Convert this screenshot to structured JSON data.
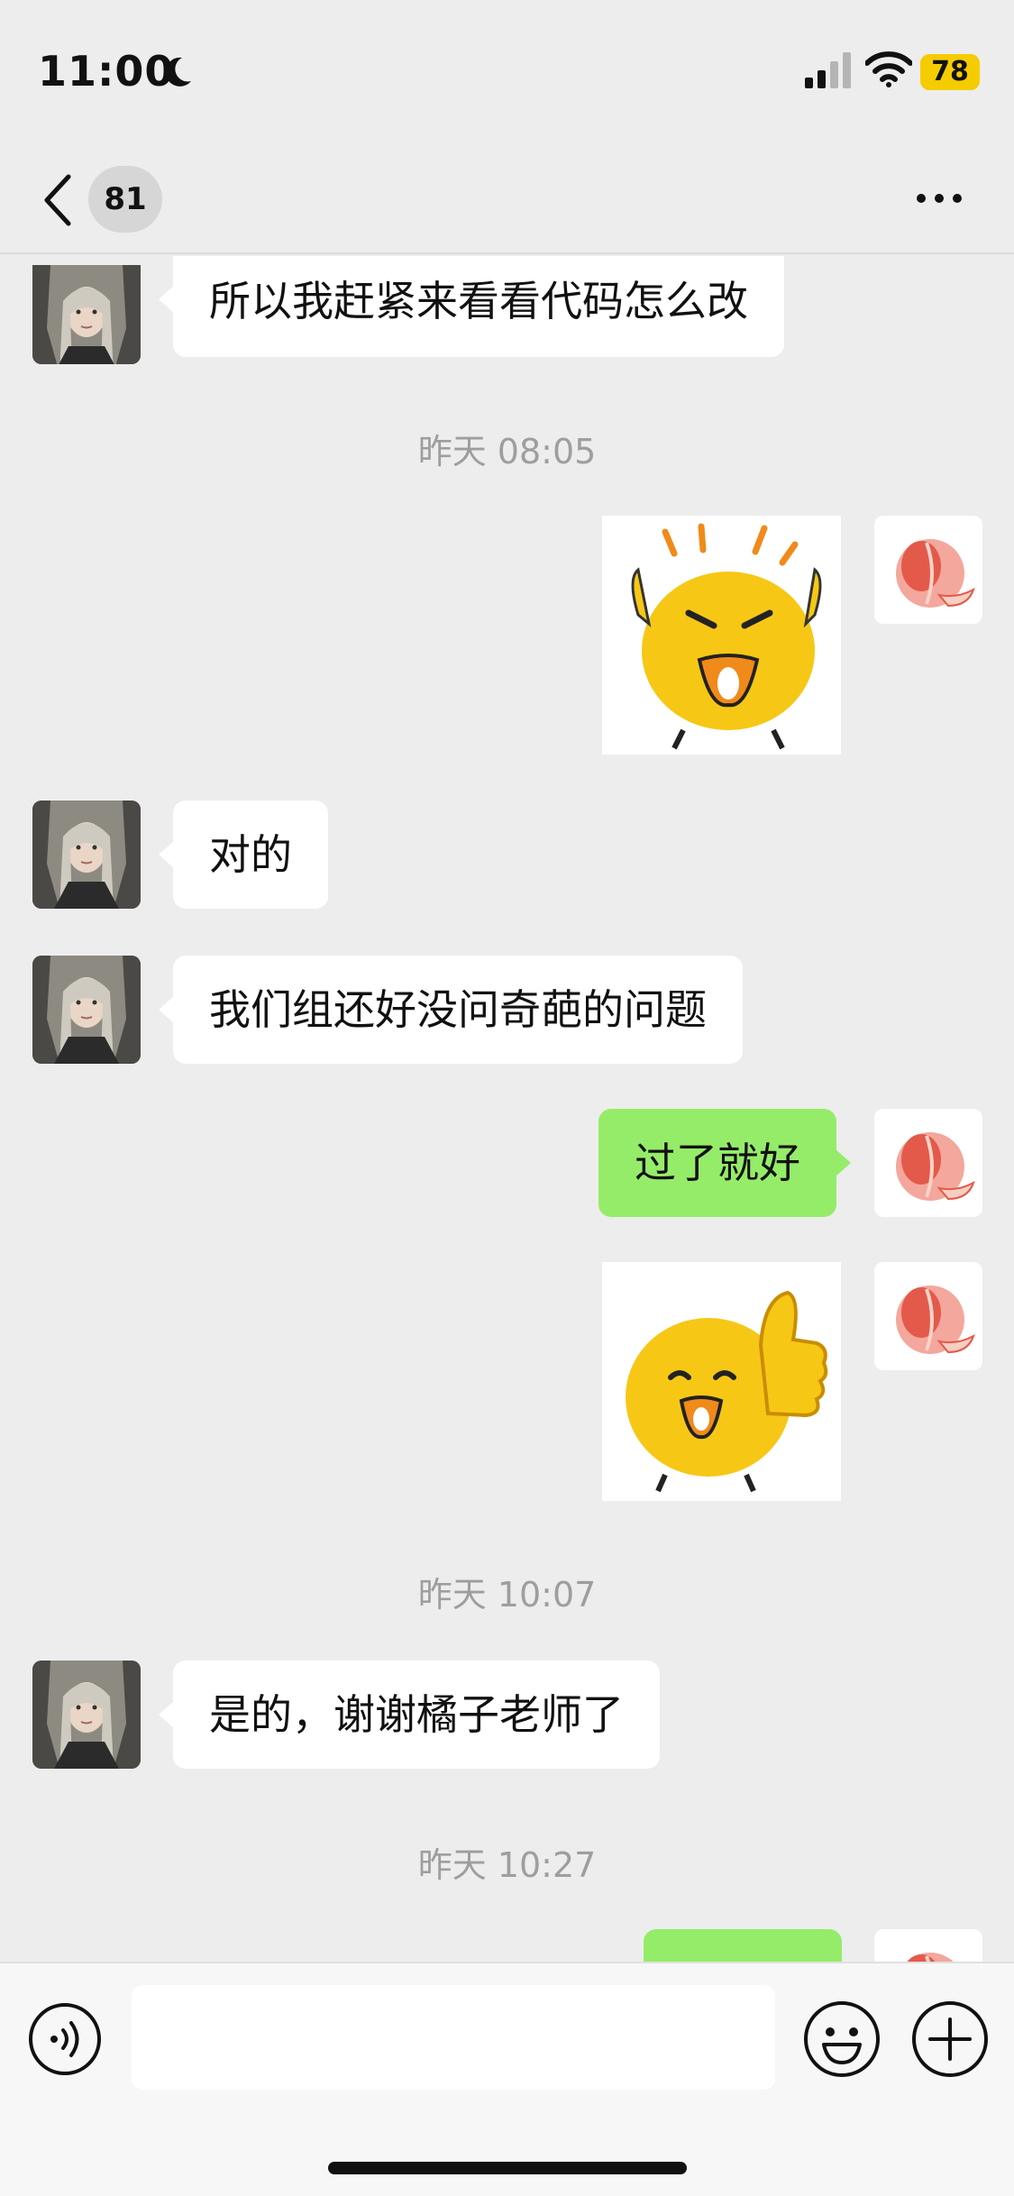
{
  "status_bar": {
    "time": "11:00",
    "battery": "78",
    "icons": [
      "moon-icon",
      "signal-icon",
      "wifi-icon",
      "battery-icon"
    ]
  },
  "nav": {
    "unread_count": "81",
    "icons": [
      "back-arrow-icon",
      "more-icon"
    ]
  },
  "messages": [
    {
      "side": "left",
      "type": "text",
      "text": "所以我赶紧来看看代码怎么改"
    },
    {
      "type": "timestamp",
      "text": "昨天 08:05"
    },
    {
      "side": "right",
      "type": "sticker",
      "sticker": "excited-yellow-blob-sticker"
    },
    {
      "side": "left",
      "type": "text",
      "text": "对的"
    },
    {
      "side": "left",
      "type": "text",
      "text": "我们组还好没问奇葩的问题"
    },
    {
      "side": "right",
      "type": "text",
      "text": "过了就好"
    },
    {
      "side": "right",
      "type": "sticker",
      "sticker": "thumbs-up-yellow-blob-sticker"
    },
    {
      "type": "timestamp",
      "text": "昨天 10:07"
    },
    {
      "side": "left",
      "type": "text",
      "text": "是的，谢谢橘子老师了"
    },
    {
      "type": "timestamp",
      "text": "昨天 10:27"
    },
    {
      "side": "right",
      "type": "text",
      "text": ""
    }
  ],
  "input_bar": {
    "value": "",
    "icons": [
      "voice-icon",
      "emoji-icon",
      "plus-icon"
    ]
  },
  "colors": {
    "background": "#ededed",
    "outgoing_bubble": "#95ec69",
    "incoming_bubble": "#ffffff",
    "timestamp": "#9e9e9e",
    "battery": "#f5cc00"
  }
}
